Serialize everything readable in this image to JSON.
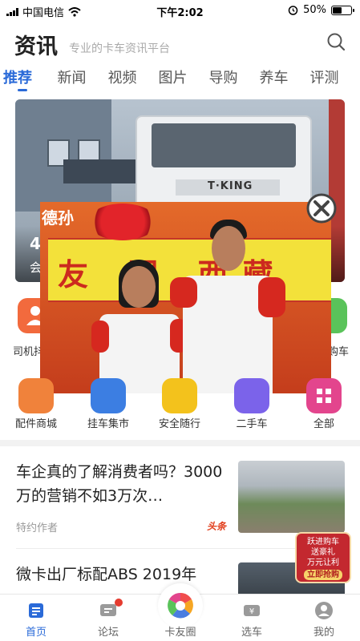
{
  "status_bar": {
    "carrier": "中国电信",
    "time": "下午2:02",
    "battery_percent": "50%",
    "battery_level": 0.5
  },
  "header": {
    "title": "资讯",
    "subtitle": "专业的卡车资讯平台",
    "search_icon": "search-icon"
  },
  "tabs": [
    {
      "label": "推荐",
      "active": true
    },
    {
      "label": "新闻"
    },
    {
      "label": "视频"
    },
    {
      "label": "图片"
    },
    {
      "label": "导购"
    },
    {
      "label": "养车"
    },
    {
      "label": "评测"
    }
  ],
  "hero": {
    "line1": "4",
    "line2": "会",
    "truck_brand": "T·KING"
  },
  "popup_ad": {
    "top_text": "德孙",
    "banner_chars": "友 国 西藏",
    "close_icon": "close-circle-icon"
  },
  "grid": {
    "row1": [
      {
        "label": "司机抖",
        "color": "#f26a3d",
        "icon": "driver-icon"
      },
      {
        "label": "",
        "color": "#4a7de0",
        "icon": "hidden-icon"
      },
      {
        "label": "",
        "color": "#f5a623",
        "icon": "hidden-icon"
      },
      {
        "label": "",
        "color": "#8a5cf5",
        "icon": "hidden-icon"
      },
      {
        "label": "购车",
        "color": "#5ac35a",
        "icon": "cart-icon"
      }
    ],
    "row2": [
      {
        "label": "配件商城",
        "color": "#f0823b",
        "icon": "parts-icon"
      },
      {
        "label": "挂车集市",
        "color": "#3c7ee2",
        "icon": "trailer-icon"
      },
      {
        "label": "安全随行",
        "color": "#f3c21c",
        "icon": "shell-icon"
      },
      {
        "label": "二手车",
        "color": "#7b63ea",
        "icon": "used-truck-icon"
      },
      {
        "label": "全部",
        "color": "#e3458d",
        "icon": "grid-all-icon"
      }
    ]
  },
  "feed": [
    {
      "title": "车企真的了解消费者吗？3000万的营销不如3万次…",
      "author": "特约作者",
      "source": "头条"
    },
    {
      "title": "微卡出厂标配ABS 2019年"
    }
  ],
  "promo": {
    "line1": "跃进购车",
    "line2": "送豪礼",
    "line3": "万元让利",
    "button": "立即抢购"
  },
  "bottom_nav": [
    {
      "label": "首页",
      "icon": "home-icon",
      "active": true
    },
    {
      "label": "论坛",
      "icon": "forum-icon",
      "badge": true
    },
    {
      "label": "卡友圈",
      "icon": "circle-icon"
    },
    {
      "label": "选车",
      "icon": "select-truck-icon"
    },
    {
      "label": "我的",
      "icon": "profile-icon"
    }
  ],
  "colors": {
    "accent": "#2a6ad8",
    "badge": "#e53b2f",
    "headline_source": "#e2411f"
  }
}
